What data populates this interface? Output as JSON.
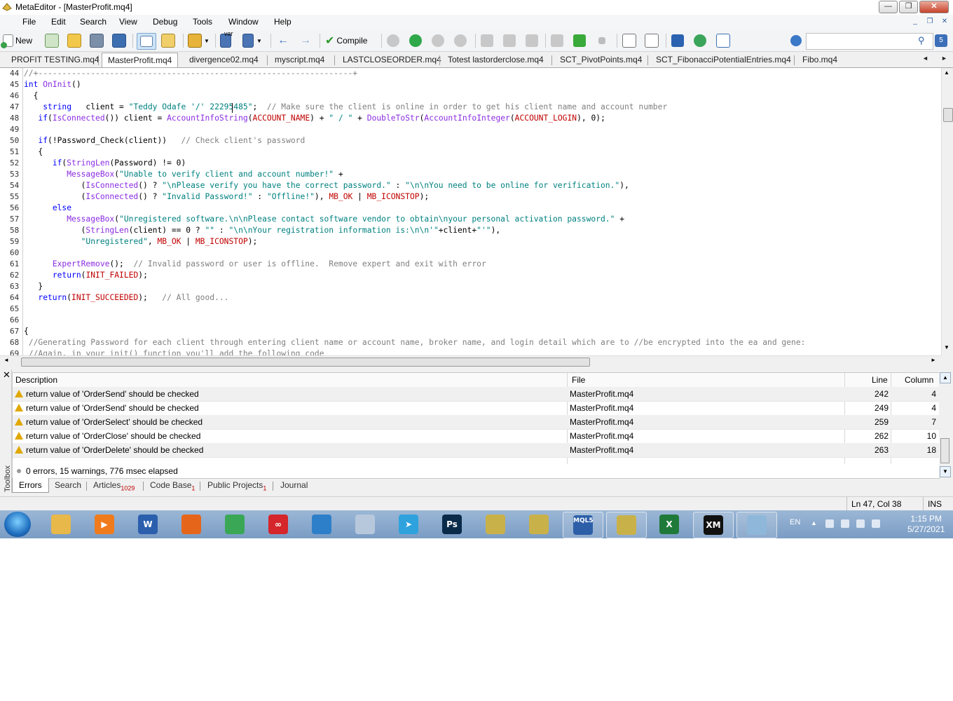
{
  "window": {
    "title": "MetaEditor - [MasterProfit.mq4]"
  },
  "menu": [
    "File",
    "Edit",
    "Search",
    "View",
    "Debug",
    "Tools",
    "Window",
    "Help"
  ],
  "toolbar": {
    "new_label": "New",
    "compile_label": "Compile",
    "search_placeholder": ""
  },
  "tabs": [
    "PROFIT TESTING.mq4",
    "MasterProfit.mq4",
    "divergence02.mq4",
    "myscript.mq4",
    "LASTCLOSEORDER.mq4",
    "Totest lastorderclose.mq4",
    "SCT_PivotPoints.mq4",
    "SCT_FibonacciPotentialEntries.mq4",
    "Fibo.mq4"
  ],
  "active_tab": "MasterProfit.mq4",
  "code": [
    {
      "n": "44",
      "html": "<span class=\"cm\">//+------------------------------------------------------------------+</span>"
    },
    {
      "n": "45",
      "html": "<span class=\"kw\">int</span> <span class=\"fn\">OnInit</span>()"
    },
    {
      "n": "46",
      "html": "  {"
    },
    {
      "n": "47",
      "html": "    <span class=\"kw\">string</span>   client = <span class=\"str\">\"Teddy Odafe '/' 22295485\"</span>;  <span class=\"cm\">// Make sure the client is online in order to get his client name and account number</span>"
    },
    {
      "n": "48",
      "html": "   <span class=\"kw\">if</span>(<span class=\"fn\">IsConnected</span>()) client = <span class=\"fn\">AccountInfoString</span>(<span class=\"cst\">ACCOUNT_NAME</span>) + <span class=\"str\">\" / \"</span> + <span class=\"fn\">DoubleToStr</span>(<span class=\"fn\">AccountInfoInteger</span>(<span class=\"cst\">ACCOUNT_LOGIN</span>), 0);"
    },
    {
      "n": "49",
      "html": ""
    },
    {
      "n": "50",
      "html": "   <span class=\"kw\">if</span>(!Password_Check(client))   <span class=\"cm\">// Check client's password</span>"
    },
    {
      "n": "51",
      "html": "   {"
    },
    {
      "n": "52",
      "html": "      <span class=\"kw\">if</span>(<span class=\"fn\">StringLen</span>(Password) != 0)"
    },
    {
      "n": "53",
      "html": "         <span class=\"fn\">MessageBox</span>(<span class=\"str\">\"Unable to verify client and account number!\"</span> +"
    },
    {
      "n": "54",
      "html": "            (<span class=\"fn\">IsConnected</span>() ? <span class=\"str\">\"\\nPlease verify you have the correct password.\"</span> : <span class=\"str\">\"\\n\\nYou need to be online for verification.\"</span>),"
    },
    {
      "n": "55",
      "html": "            (<span class=\"fn\">IsConnected</span>() ? <span class=\"str\">\"Invalid Password!\"</span> : <span class=\"str\">\"Offline!\"</span>), <span class=\"cst\">MB_OK</span> | <span class=\"cst\">MB_ICONSTOP</span>);"
    },
    {
      "n": "56",
      "html": "      <span class=\"kw\">else</span>"
    },
    {
      "n": "57",
      "html": "         <span class=\"fn\">MessageBox</span>(<span class=\"str\">\"Unregistered software.\\n\\nPlease contact software vendor to obtain\\nyour personal activation password.\"</span> +"
    },
    {
      "n": "58",
      "html": "            (<span class=\"fn\">StringLen</span>(client) == 0 ? <span class=\"str\">\"\"</span> : <span class=\"str\">\"\\n\\nYour registration information is:\\n\\n'\"</span>+client+<span class=\"str\">\"'\"</span>),"
    },
    {
      "n": "59",
      "html": "            <span class=\"str\">\"Unregistered\"</span>, <span class=\"cst\">MB_OK</span> | <span class=\"cst\">MB_ICONSTOP</span>);"
    },
    {
      "n": "60",
      "html": ""
    },
    {
      "n": "61",
      "html": "      <span class=\"fn\">ExpertRemove</span>();  <span class=\"cm\">// Invalid password or user is offline.  Remove expert and exit with error</span>"
    },
    {
      "n": "62",
      "html": "      <span class=\"kw\">return</span>(<span class=\"cst\">INIT_FAILED</span>);"
    },
    {
      "n": "63",
      "html": "   }"
    },
    {
      "n": "64",
      "html": "   <span class=\"kw\">return</span>(<span class=\"cst\">INIT_SUCCEEDED</span>);   <span class=\"cm\">// All good...</span>"
    },
    {
      "n": "65",
      "html": ""
    },
    {
      "n": "66",
      "html": ""
    },
    {
      "n": "67",
      "html": "{"
    },
    {
      "n": "68",
      "html": " <span class=\"cm\">//Generating Password for each client through entering client name or account name, broker name, and login detail which are to //be encrypted into the ea and gene:</span>"
    },
    {
      "n": "69",
      "html": " <span class=\"cm\">//Again, in your init() function you'll add the following code</span>"
    }
  ],
  "errors": {
    "headers": {
      "description": "Description",
      "file": "File",
      "line": "Line",
      "column": "Column"
    },
    "rows": [
      {
        "description": "return value of 'OrderSend' should be checked",
        "file": "MasterProfit.mq4",
        "line": "242",
        "column": "4"
      },
      {
        "description": "return value of 'OrderSend' should be checked",
        "file": "MasterProfit.mq4",
        "line": "249",
        "column": "4"
      },
      {
        "description": "return value of 'OrderSelect' should be checked",
        "file": "MasterProfit.mq4",
        "line": "259",
        "column": "7"
      },
      {
        "description": "return value of 'OrderClose' should be checked",
        "file": "MasterProfit.mq4",
        "line": "262",
        "column": "10"
      },
      {
        "description": "return value of 'OrderDelete' should be checked",
        "file": "MasterProfit.mq4",
        "line": "263",
        "column": "18"
      }
    ],
    "summary": "0 errors, 15 warnings, 776 msec elapsed"
  },
  "toolbox": {
    "side_label": "Toolbox",
    "tabs": [
      {
        "label": "Errors",
        "badge": ""
      },
      {
        "label": "Search",
        "badge": ""
      },
      {
        "label": "Articles",
        "badge": "1029"
      },
      {
        "label": "Code Base",
        "badge": "1"
      },
      {
        "label": "Public Projects",
        "badge": "1"
      },
      {
        "label": "Journal",
        "badge": ""
      }
    ]
  },
  "status": {
    "position": "Ln 47, Col 38",
    "mode": "INS"
  },
  "taskbar": {
    "apps": [
      {
        "name": "explorer",
        "color": "#e8b84a",
        "glyph": ""
      },
      {
        "name": "media",
        "color": "#f07b1c",
        "glyph": "▶"
      },
      {
        "name": "word",
        "color": "#2b5fad",
        "glyph": "W"
      },
      {
        "name": "firefox",
        "color": "#e5661a",
        "glyph": ""
      },
      {
        "name": "chrome",
        "color": "#3aa757",
        "glyph": ""
      },
      {
        "name": "acrobat",
        "color": "#d4262b",
        "glyph": "∞"
      },
      {
        "name": "globe",
        "color": "#2e7fc9",
        "glyph": ""
      },
      {
        "name": "calculator",
        "color": "#b8c8dc",
        "glyph": ""
      },
      {
        "name": "telegram",
        "color": "#2ea2dd",
        "glyph": "➤"
      },
      {
        "name": "photoshop",
        "color": "#0a2a4a",
        "glyph": "Ps"
      },
      {
        "name": "metaeditor-a",
        "color": "#c9b14a",
        "glyph": ""
      },
      {
        "name": "metaeditor-b",
        "color": "#c9b14a",
        "glyph": ""
      },
      {
        "name": "mql5",
        "color": "#2d5fa8",
        "glyph": "MQL5"
      },
      {
        "name": "metaeditor-c",
        "color": "#c9b14a",
        "glyph": ""
      },
      {
        "name": "excel",
        "color": "#1f7a3a",
        "glyph": "X"
      },
      {
        "name": "xm",
        "color": "#111111",
        "glyph": "XM"
      },
      {
        "name": "notepad",
        "color": "#8fb7d9",
        "glyph": ""
      }
    ],
    "lang": "EN",
    "time": "1:15 PM",
    "date": "5/27/2021"
  }
}
